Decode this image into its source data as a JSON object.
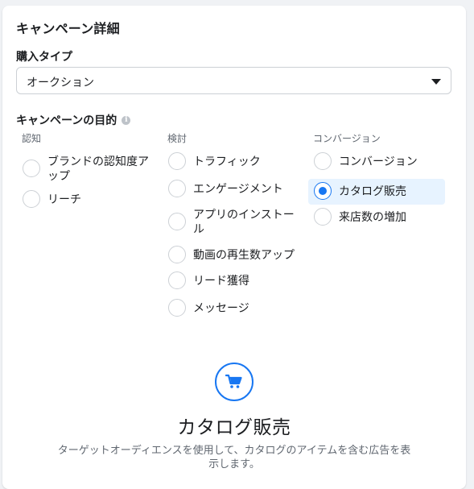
{
  "section_title": "キャンペーン詳細",
  "buying_type": {
    "label": "購入タイプ",
    "value": "オークション"
  },
  "objective": {
    "label": "キャンペーンの目的",
    "info_icon": "i",
    "columns": [
      {
        "heading": "認知",
        "options": [
          {
            "label": "ブランドの認知度アップ",
            "selected": false
          },
          {
            "label": "リーチ",
            "selected": false
          }
        ]
      },
      {
        "heading": "検討",
        "options": [
          {
            "label": "トラフィック",
            "selected": false
          },
          {
            "label": "エンゲージメント",
            "selected": false
          },
          {
            "label": "アプリのインストール",
            "selected": false
          },
          {
            "label": "動画の再生数アップ",
            "selected": false
          },
          {
            "label": "リード獲得",
            "selected": false
          },
          {
            "label": "メッセージ",
            "selected": false
          }
        ]
      },
      {
        "heading": "コンバージョン",
        "options": [
          {
            "label": "コンバージョン",
            "selected": false
          },
          {
            "label": "カタログ販売",
            "selected": true
          },
          {
            "label": "来店数の増加",
            "selected": false
          }
        ]
      }
    ]
  },
  "feature": {
    "icon": "shopping-cart-icon",
    "title": "カタログ販売",
    "description": "ターゲットオーディエンスを使用して、カタログのアイテムを含む広告を表示します。"
  },
  "colors": {
    "accent": "#1877f2",
    "selected_bg": "#e7f3ff"
  }
}
